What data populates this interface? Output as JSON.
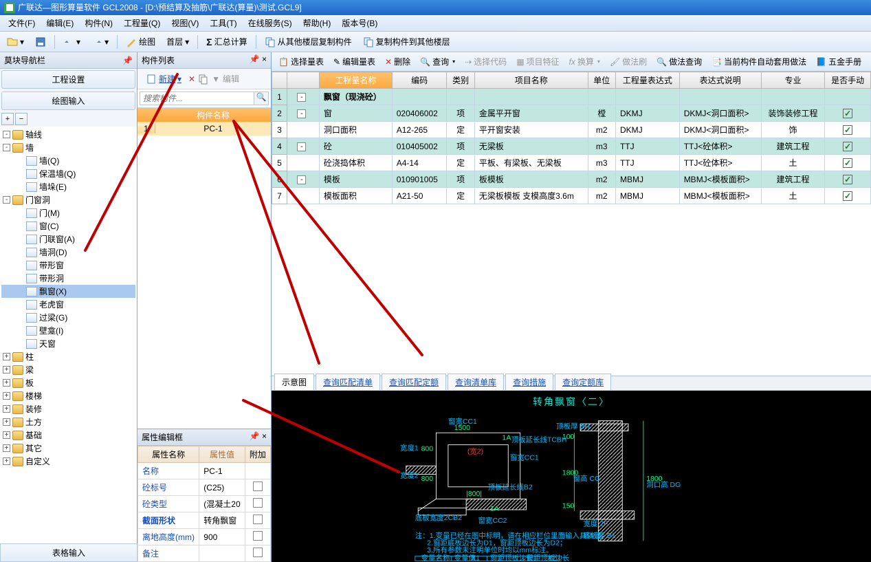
{
  "title": "广联达—图形算量软件 GCL2008 - [D:\\预结算及抽筋\\广联达(算量)\\测试.GCL9]",
  "menu": [
    "文件(F)",
    "编辑(E)",
    "构件(N)",
    "工程量(Q)",
    "视图(V)",
    "工具(T)",
    "在线服务(S)",
    "帮助(H)",
    "版本号(B)"
  ],
  "toolbar1": {
    "draw": "绘图",
    "floor": "首层",
    "sum": "汇总计算",
    "copyFrom": "从其他楼层复制构件",
    "copyTo": "复制构件到其他楼层"
  },
  "leftPanel": {
    "title": "莫块导航栏",
    "tab1": "工程设置",
    "tab2": "绘图输入",
    "bottomTab": "表格输入"
  },
  "tree": [
    {
      "lvl": 0,
      "exp": "-",
      "ico": "folder",
      "label": "轴线"
    },
    {
      "lvl": 0,
      "exp": "-",
      "ico": "folder",
      "label": "墙"
    },
    {
      "lvl": 1,
      "exp": "",
      "ico": "file",
      "label": "墙(Q)"
    },
    {
      "lvl": 1,
      "exp": "",
      "ico": "file",
      "label": "保温墙(Q)"
    },
    {
      "lvl": 1,
      "exp": "",
      "ico": "file",
      "label": "墙垛(E)"
    },
    {
      "lvl": 0,
      "exp": "-",
      "ico": "folder",
      "label": "门窗洞"
    },
    {
      "lvl": 1,
      "exp": "",
      "ico": "file",
      "label": "门(M)"
    },
    {
      "lvl": 1,
      "exp": "",
      "ico": "file",
      "label": "窗(C)"
    },
    {
      "lvl": 1,
      "exp": "",
      "ico": "file",
      "label": "门联窗(A)"
    },
    {
      "lvl": 1,
      "exp": "",
      "ico": "file",
      "label": "墙洞(D)"
    },
    {
      "lvl": 1,
      "exp": "",
      "ico": "file",
      "label": "带形窗"
    },
    {
      "lvl": 1,
      "exp": "",
      "ico": "file",
      "label": "带形洞"
    },
    {
      "lvl": 1,
      "exp": "",
      "ico": "file",
      "label": "飘窗(X)",
      "sel": true
    },
    {
      "lvl": 1,
      "exp": "",
      "ico": "file",
      "label": "老虎窗"
    },
    {
      "lvl": 1,
      "exp": "",
      "ico": "file",
      "label": "过梁(G)"
    },
    {
      "lvl": 1,
      "exp": "",
      "ico": "file",
      "label": "壁龛(I)"
    },
    {
      "lvl": 1,
      "exp": "",
      "ico": "file",
      "label": "天窗"
    },
    {
      "lvl": 0,
      "exp": "+",
      "ico": "folder",
      "label": "柱"
    },
    {
      "lvl": 0,
      "exp": "+",
      "ico": "folder",
      "label": "梁"
    },
    {
      "lvl": 0,
      "exp": "+",
      "ico": "folder",
      "label": "板"
    },
    {
      "lvl": 0,
      "exp": "+",
      "ico": "folder",
      "label": "楼梯"
    },
    {
      "lvl": 0,
      "exp": "+",
      "ico": "folder",
      "label": "装修"
    },
    {
      "lvl": 0,
      "exp": "+",
      "ico": "folder",
      "label": "土方"
    },
    {
      "lvl": 0,
      "exp": "+",
      "ico": "folder",
      "label": "基础"
    },
    {
      "lvl": 0,
      "exp": "+",
      "ico": "folder",
      "label": "其它"
    },
    {
      "lvl": 0,
      "exp": "+",
      "ico": "folder",
      "label": "自定义"
    }
  ],
  "midPanel": {
    "title": "构件列表",
    "new": "新建",
    "edit": "编辑",
    "searchPlaceholder": "搜索构件...",
    "header": "构件名称",
    "row1num": "1",
    "row1name": "PC-1"
  },
  "propPanel": {
    "title": "属性编辑框",
    "cols": [
      "属性名称",
      "属性值",
      "附加"
    ],
    "rows": [
      {
        "k": "名称",
        "v": "PC-1",
        "chk": false
      },
      {
        "k": "砼标号",
        "v": "(C25)",
        "chk": true
      },
      {
        "k": "砼类型",
        "v": "(混凝土20",
        "chk": true
      },
      {
        "k": "截面形状",
        "v": "转角飘窗",
        "chk": true,
        "hl": true
      },
      {
        "k": "离地高度(mm)",
        "v": "900",
        "chk": true
      },
      {
        "k": "备注",
        "v": "",
        "chk": true
      }
    ]
  },
  "rightTools": {
    "selectQty": "选择量表",
    "editQty": "编辑量表",
    "delete": "删除",
    "query": "查询",
    "selectCode": "选择代码",
    "projFeat": "项目特征",
    "convert": "换算",
    "doFmt": "做法刷",
    "queryFmt": "做法查询",
    "autoApply": "当前构件自动套用做法",
    "hardware": "五金手册"
  },
  "grid": {
    "headers": [
      "",
      "",
      "工程量名称",
      "编码",
      "类别",
      "项目名称",
      "单位",
      "工程量表达式",
      "表达式说明",
      "专业",
      "是否手动"
    ],
    "rows": [
      {
        "n": "1",
        "cls": "teal",
        "exp": "-",
        "name": "飘窗（现浇砼）",
        "bold": true
      },
      {
        "n": "2",
        "cls": "teal",
        "exp": "-",
        "name": "窗",
        "code": "020406002",
        "type": "项",
        "proj": "金属平开窗",
        "unit": "樘",
        "expr": "DKMJ",
        "desc": "DKMJ<洞口面积>",
        "spec": "装饰装修工程",
        "chk": true
      },
      {
        "n": "3",
        "cls": "w",
        "name": "洞口面积",
        "code": "A12-265",
        "type": "定",
        "proj": "平开窗安装",
        "unit": "m2",
        "expr": "DKMJ",
        "desc": "DKMJ<洞口面积>",
        "spec": "饰",
        "chk": true
      },
      {
        "n": "4",
        "cls": "teal",
        "exp": "-",
        "name": "砼",
        "code": "010405002",
        "type": "项",
        "proj": "无梁板",
        "unit": "m3",
        "expr": "TTJ",
        "desc": "TTJ<砼体积>",
        "spec": "建筑工程",
        "chk": true
      },
      {
        "n": "5",
        "cls": "w",
        "name": "砼浇捣体积",
        "code": "A4-14",
        "type": "定",
        "proj": "平板、有梁板、无梁板",
        "unit": "m3",
        "expr": "TTJ",
        "desc": "TTJ<砼体积>",
        "spec": "土",
        "chk": true
      },
      {
        "n": "6",
        "cls": "teal",
        "exp": "-",
        "name": "模板",
        "code": "010901005",
        "type": "项",
        "proj": "板模板",
        "unit": "m2",
        "expr": "MBMJ",
        "desc": "MBMJ<模板面积>",
        "spec": "建筑工程",
        "chk": true
      },
      {
        "n": "7",
        "cls": "w",
        "name": "模板面积",
        "code": "A21-50",
        "type": "定",
        "proj": "无梁板模板 支模高度3.6m",
        "unit": "m2",
        "expr": "MBMJ",
        "desc": "MBMJ<模板面积>",
        "spec": "土",
        "chk": true
      }
    ]
  },
  "diagTabs": [
    "示意图",
    "查询匹配清单",
    "查询匹配定额",
    "查询清单库",
    "查询措施",
    "查询定额库"
  ],
  "diagTitle": "转角飘窗〈二〉"
}
